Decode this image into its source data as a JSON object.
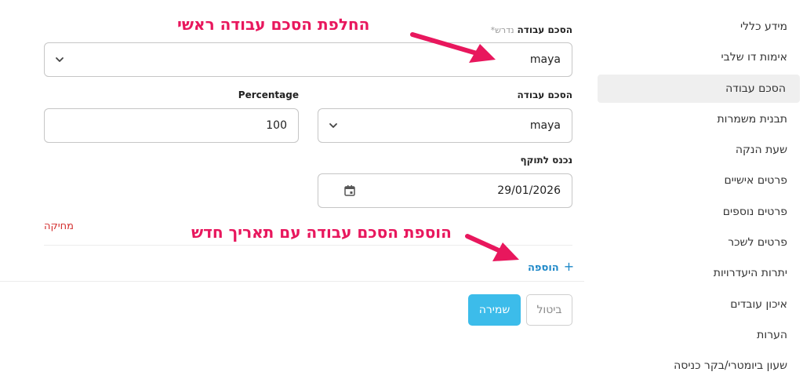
{
  "sidebar": {
    "items": [
      {
        "label": "מידע כללי"
      },
      {
        "label": "אימות דו שלבי"
      },
      {
        "label": "הסכם עבודה"
      },
      {
        "label": "תבנית משמרות"
      },
      {
        "label": "שעת הנקה"
      },
      {
        "label": "פרטים אישיים"
      },
      {
        "label": "פרטים נוספים"
      },
      {
        "label": "פרטים לשכר"
      },
      {
        "label": "יתרות היעדרויות"
      },
      {
        "label": "איכון עובדים"
      },
      {
        "label": "הערות"
      },
      {
        "label": "שעון ביומטרי/בקר כניסה"
      }
    ]
  },
  "form": {
    "main_agreement_label": "הסכם עבודה",
    "required_hint": "נדרש*",
    "main_agreement_value": "maya",
    "agreement_label": "הסכם עבודה",
    "agreement_value": "maya",
    "percentage_label": "Percentage",
    "percentage_value": "100",
    "effective_label": "נכנס לתוקף",
    "effective_date": "29/01/2026",
    "delete_label": "מחיקה",
    "add_label": "הוספה",
    "add_icon": "+",
    "cancel_label": "ביטול",
    "save_label": "שמירה"
  },
  "annotations": {
    "top": "החלפת הסכם עבודה ראשי",
    "bottom": "הוספת הסכם עבודה עם תאריך חדש",
    "color": "#e8175d"
  },
  "colors": {
    "accent": "#3cbcea",
    "danger": "#d32f2f",
    "link": "#1e88c8",
    "active_bg": "#efefef"
  }
}
